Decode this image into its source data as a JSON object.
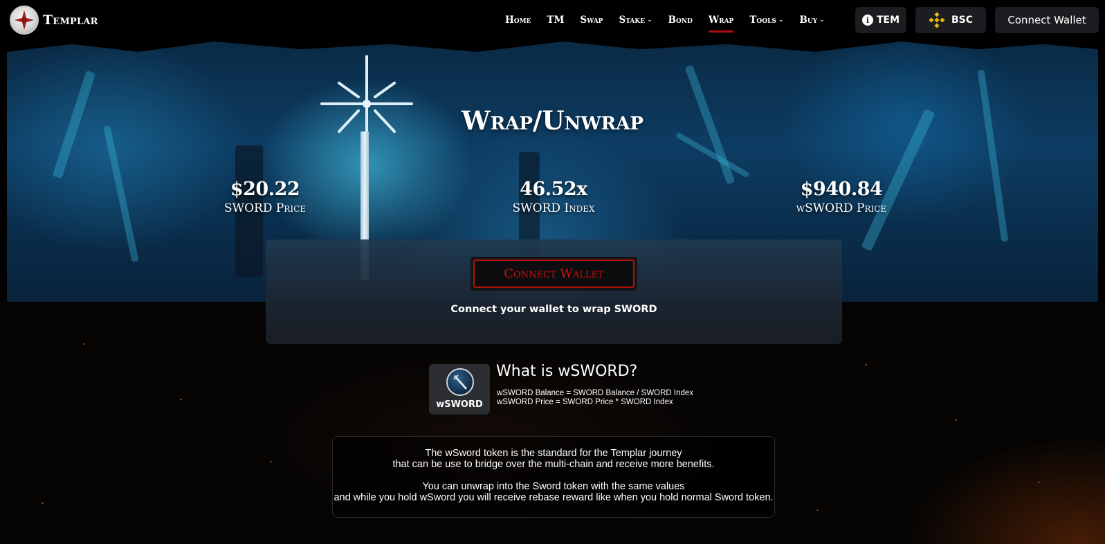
{
  "brand": {
    "name": "Templar",
    "logo_icon": "templar-cross-icon"
  },
  "nav": {
    "items": [
      {
        "label": "Home",
        "dropdown": false,
        "active": false
      },
      {
        "label": "TM",
        "dropdown": false,
        "active": false
      },
      {
        "label": "Swap",
        "dropdown": false,
        "active": false
      },
      {
        "label": "Stake",
        "dropdown": true,
        "active": false
      },
      {
        "label": "Bond",
        "dropdown": false,
        "active": false
      },
      {
        "label": "Wrap",
        "dropdown": false,
        "active": true
      },
      {
        "label": "Tools",
        "dropdown": true,
        "active": false
      },
      {
        "label": "Buy",
        "dropdown": true,
        "active": false
      }
    ],
    "tem_button": {
      "label": "TEM",
      "icon": "info-icon"
    },
    "network_button": {
      "label": "BSC",
      "icon": "bnb-icon"
    },
    "wallet_button": {
      "label": "Connect Wallet"
    }
  },
  "hero": {
    "title": "Wrap/Unwrap",
    "stats": [
      {
        "value": "$20.22",
        "label": "SWORD Price"
      },
      {
        "value": "46.52x",
        "label": "SWORD Index"
      },
      {
        "value": "$940.84",
        "label": "wSWORD Price"
      }
    ]
  },
  "card": {
    "button_label": "Connect Wallet",
    "message": "Connect your wallet to wrap SWORD"
  },
  "info": {
    "token_label": "wSWORD",
    "title": "What is wSWORD?",
    "formula_balance": "wSWORD Balance = SWORD Balance / SWORD Index",
    "formula_price": "wSWORD Price = SWORD Price * SWORD Index"
  },
  "description": {
    "line1": "The wSword token is the standard for the Templar journey",
    "line2": "that can be use to bridge over the multi-chain and receive more benefits.",
    "line3": "You can unwrap into the Sword token with the same values",
    "line4": "and while you hold wSword you will receive rebase reward like when you hold normal Sword token."
  },
  "colors": {
    "accent_red": "#b2120f",
    "header_button_bg": "#1c1d20",
    "page_bg": "#000000",
    "bnb_yellow": "#f0b90b"
  }
}
